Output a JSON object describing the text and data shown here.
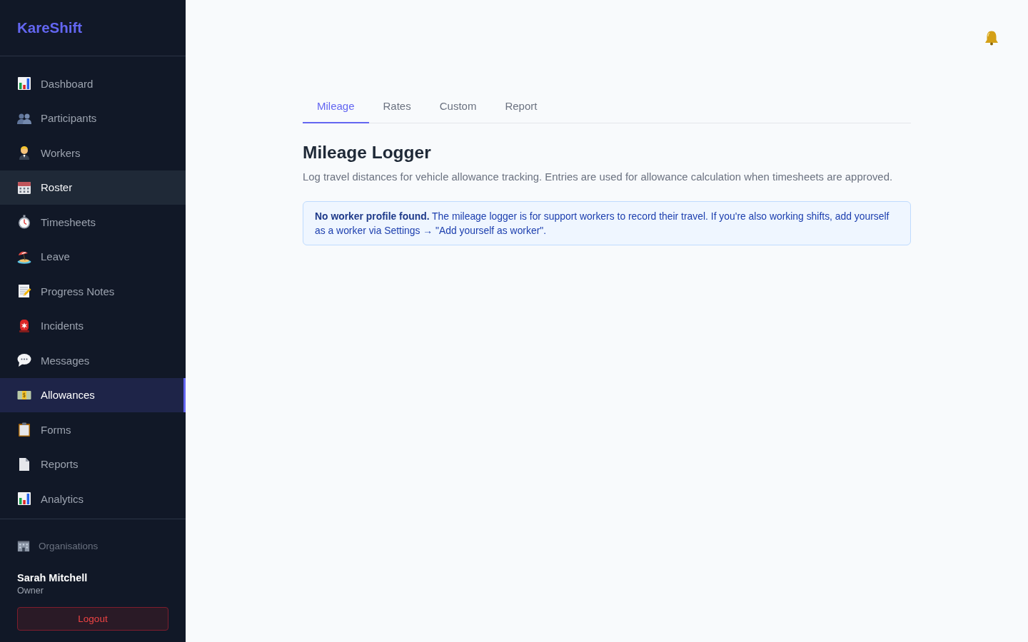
{
  "sidebar": {
    "logo": "KareShift",
    "nav_items": [
      {
        "label": "Dashboard",
        "selected": false,
        "hovered": false
      },
      {
        "label": "Participants",
        "selected": false,
        "hovered": false
      },
      {
        "label": "Workers",
        "selected": false,
        "hovered": false
      },
      {
        "label": "Roster",
        "selected": false,
        "hovered": true
      },
      {
        "label": "Timesheets",
        "selected": false,
        "hovered": false
      },
      {
        "label": "Leave",
        "selected": false,
        "hovered": false
      },
      {
        "label": "Progress Notes",
        "selected": false,
        "hovered": false
      },
      {
        "label": "Incidents",
        "selected": false,
        "hovered": false
      },
      {
        "label": "Messages",
        "selected": false,
        "hovered": false
      },
      {
        "label": "Allowances",
        "selected": true,
        "hovered": false
      },
      {
        "label": "Forms",
        "selected": false,
        "hovered": false
      },
      {
        "label": "Reports",
        "selected": false,
        "hovered": false
      },
      {
        "label": "Analytics",
        "selected": false,
        "hovered": false
      }
    ],
    "organisations_link": "Organisations",
    "user": {
      "name": "Sarah Mitchell",
      "role": "Owner"
    },
    "logout_button": "Logout"
  },
  "tabs": [
    {
      "label": "Mileage",
      "selected": true
    },
    {
      "label": "Rates",
      "selected": false
    },
    {
      "label": "Custom",
      "selected": false
    },
    {
      "label": "Report",
      "selected": false
    }
  ],
  "page": {
    "title": "Mileage Logger",
    "description": "Log travel distances for vehicle allowance tracking. Entries are used for allowance calculation when timesheets are approved.",
    "alert": "**No worker profile found.** The mileage logger is for support workers to record their travel. If you're also working shifts, add yourself as a worker via Settings → \"Add yourself as worker\"."
  }
}
